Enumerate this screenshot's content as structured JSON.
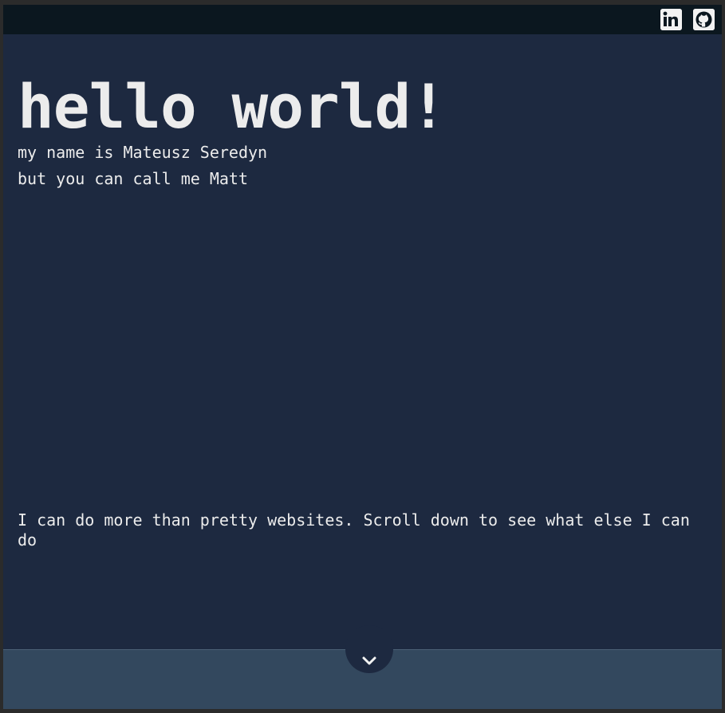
{
  "header": {
    "links": [
      {
        "icon": "linkedin-icon"
      },
      {
        "icon": "github-icon"
      }
    ]
  },
  "hero": {
    "title": "hello world!",
    "line1": "my name is Mateusz Seredyn",
    "line2": "but you can call me Matt"
  },
  "tagline": "I can do more than pretty websites. Scroll down to see what else I can do",
  "footer": {
    "scroll_icon": "chevron-down-icon"
  },
  "colors": {
    "background": "#1d2940",
    "topbar": "#0b171f",
    "footer": "#33485e",
    "text": "#ececec"
  }
}
